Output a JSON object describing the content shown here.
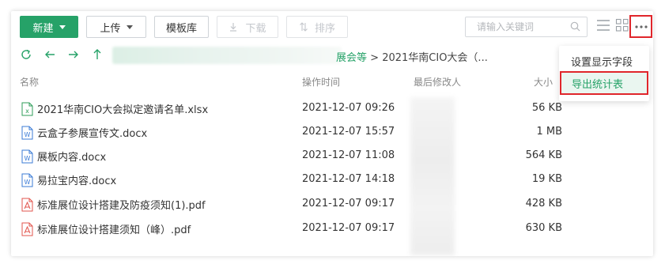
{
  "toolbar": {
    "new_label": "新建",
    "upload_label": "上传",
    "template_label": "模板库",
    "download_label": "下载",
    "sort_label": "排序"
  },
  "search": {
    "placeholder": "请输入关键词"
  },
  "breadcrumb": {
    "parent": "展会等",
    "separator": ">",
    "current": "2021华南CIO大会（..."
  },
  "columns": {
    "name": "名称",
    "modified_time": "操作时间",
    "modifier": "最后修改人",
    "size": "大小"
  },
  "files": [
    {
      "name": "2021华南CIO大会拟定邀请名单.xlsx",
      "type": "xlsx",
      "time": "2021-12-07 09:26",
      "size": "56 KB"
    },
    {
      "name": "云盒子参展宣传文.docx",
      "type": "docx",
      "time": "2021-12-07 15:57",
      "size": "1 MB"
    },
    {
      "name": "展板内容.docx",
      "type": "docx",
      "time": "2021-12-07 11:08",
      "size": "564 KB"
    },
    {
      "name": "易拉宝内容.docx",
      "type": "docx",
      "time": "2021-12-07 14:18",
      "size": "19 KB"
    },
    {
      "name": "标准展位设计搭建及防疫须知(1).pdf",
      "type": "pdf",
      "time": "2021-12-07 09:17",
      "size": "428 KB"
    },
    {
      "name": "标准展位设计搭建须知（峰）.pdf",
      "type": "pdf",
      "time": "2021-12-07 09:17",
      "size": "630 KB"
    }
  ],
  "menu": {
    "items": [
      {
        "label": "设置显示字段"
      },
      {
        "label": "导出统计表"
      }
    ]
  },
  "colors": {
    "brand_green": "#26a268",
    "highlight_red": "#e0262b",
    "word_blue": "#3b7bd6",
    "excel_green": "#2f9e5a",
    "pdf_red": "#e2554d"
  }
}
